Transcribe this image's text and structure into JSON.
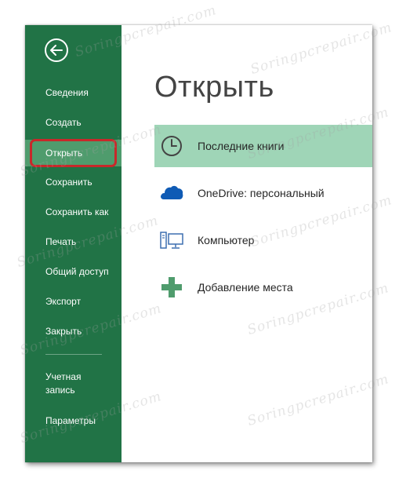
{
  "sidebar": {
    "items": [
      {
        "label": "Сведения"
      },
      {
        "label": "Создать"
      },
      {
        "label": "Открыть"
      },
      {
        "label": "Сохранить"
      },
      {
        "label": "Сохранить как"
      },
      {
        "label": "Печать"
      },
      {
        "label": "Общий доступ"
      },
      {
        "label": "Экспорт"
      },
      {
        "label": "Закрыть"
      }
    ],
    "account_line1": "Учетная",
    "account_line2": "запись",
    "options_label": "Параметры",
    "selected": "Открыть"
  },
  "main": {
    "title": "Открыть",
    "places": [
      {
        "label": "Последние книги",
        "icon": "clock-icon"
      },
      {
        "label": "OneDrive: персональный",
        "icon": "onedrive-cloud-icon"
      },
      {
        "label": "Компьютер",
        "icon": "computer-icon"
      },
      {
        "label": "Добавление места",
        "icon": "plus-icon"
      }
    ]
  },
  "watermark": {
    "text": "Soringpcrepair.com"
  },
  "colors": {
    "sidebar": "#217346",
    "sidebar_selected": "#4f9c6d",
    "place_selected": "#9fd5b7",
    "highlight_ring": "#c8282a",
    "onedrive_blue": "#0f5bb5",
    "plus_green": "#4f9c6d"
  }
}
